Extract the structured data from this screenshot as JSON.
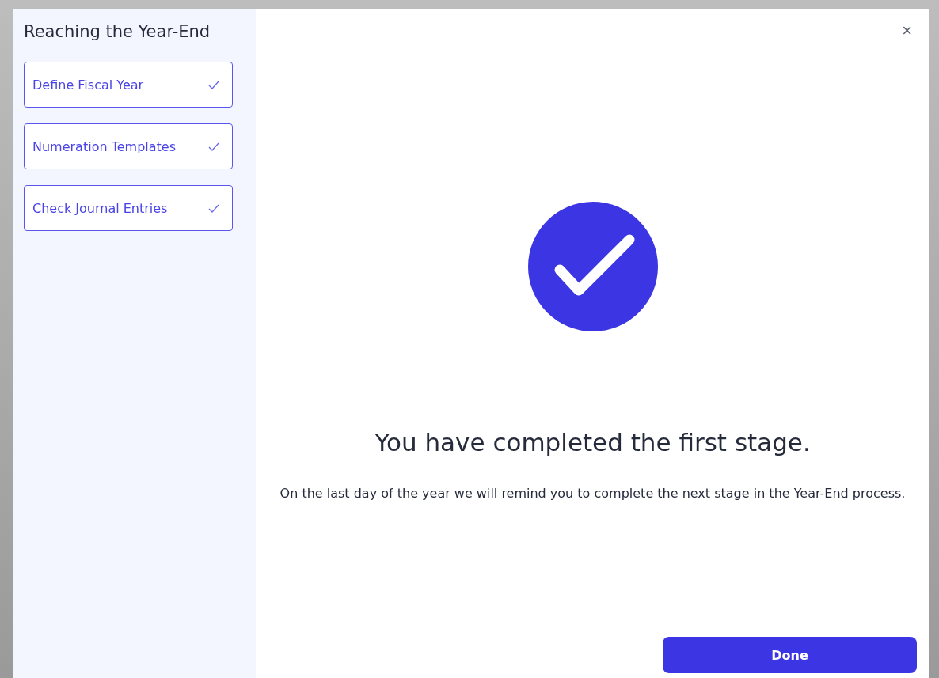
{
  "sidebar": {
    "title": "Reaching the Year-End",
    "steps": [
      {
        "label": "Define Fiscal Year",
        "completed": true
      },
      {
        "label": "Numeration Templates",
        "completed": true
      },
      {
        "label": "Check Journal Entries",
        "completed": true
      }
    ]
  },
  "main": {
    "close": "×",
    "heading": "You have completed the first stage.",
    "message": "On the last day of the year we will remind you to complete the next stage in the Year-End process.",
    "button": "Done"
  }
}
